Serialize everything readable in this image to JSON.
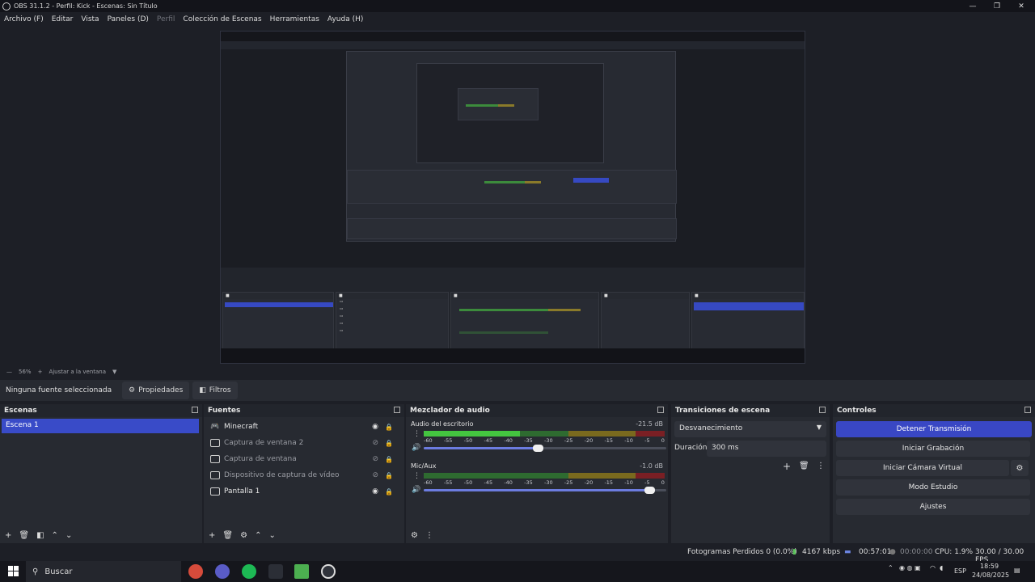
{
  "window": {
    "title": "OBS 31.1.2 - Perfil: Kick - Escenas: Sin Título"
  },
  "menu": [
    "Archivo (F)",
    "Editar",
    "Vista",
    "Paneles (D)",
    "Perfil",
    "Colección de Escenas",
    "Herramientas",
    "Ayuda (H)"
  ],
  "zoom": {
    "level": "56%",
    "fit_label": "Ajustar a la ventana"
  },
  "props_bar": {
    "no_source": "Ninguna fuente seleccionada",
    "properties": "Propiedades",
    "filters": "Filtros"
  },
  "scenes": {
    "title": "Escenas",
    "items": [
      "Escena 1"
    ]
  },
  "sources": {
    "title": "Fuentes",
    "items": [
      {
        "label": "Minecraft",
        "visible": true
      },
      {
        "label": "Captura de ventana 2",
        "visible": false
      },
      {
        "label": "Captura de ventana",
        "visible": false
      },
      {
        "label": "Dispositivo de captura de vídeo",
        "visible": false
      },
      {
        "label": "Pantalla 1",
        "visible": true
      }
    ]
  },
  "mixer": {
    "title": "Mezclador de audio",
    "ticks": [
      "-60",
      "-55",
      "-50",
      "-45",
      "-40",
      "-35",
      "-30",
      "-25",
      "-20",
      "-15",
      "-10",
      "-5",
      "0"
    ],
    "channels": [
      {
        "name": "Audio del escritorio",
        "db": "-21.5 dB",
        "level": 0.4,
        "volume": 0.47
      },
      {
        "name": "Mic/Aux",
        "db": "-1.0 dB",
        "level": 0.0,
        "volume": 0.93
      }
    ]
  },
  "transitions": {
    "title": "Transiciones de escena",
    "selected": "Desvanecimiento",
    "duration_label": "Duración",
    "duration_value": "300 ms"
  },
  "controls": {
    "title": "Controles",
    "stop_stream": "Detener Transmisión",
    "start_record": "Iniciar Grabación",
    "virtual_cam": "Iniciar Cámara Virtual",
    "studio_mode": "Modo Estudio",
    "settings": "Ajustes"
  },
  "status": {
    "dropped": "Fotogramas Perdidos 0 (0.0%)",
    "bitrate": "4167 kbps",
    "stream_time": "00:57:01",
    "rec_time": "00:00:00",
    "cpu": "CPU: 1.9%",
    "fps": "30.00 / 30.00 FPS"
  },
  "taskbar": {
    "search": "Buscar",
    "lang": "ESP",
    "time": "18:59",
    "date": "24/08/2025"
  },
  "colors": {
    "accent": "#3947c4",
    "panel": "#272a31",
    "bg": "#1d1f26"
  }
}
